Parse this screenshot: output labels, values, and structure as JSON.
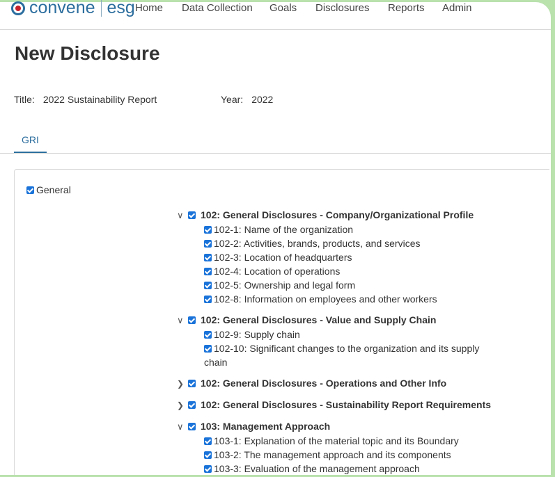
{
  "nav": {
    "logo_left": "convene",
    "logo_right": "esg",
    "items": [
      "Home",
      "Data Collection",
      "Goals",
      "Disclosures",
      "Reports",
      "Admin"
    ]
  },
  "page_title": "New Disclosure",
  "meta": {
    "title_label": "Title:",
    "title_value": "2022 Sustainability Report",
    "year_label": "Year:",
    "year_value": "2022"
  },
  "tabs": [
    "GRI"
  ],
  "general": {
    "label": "General",
    "checked": true
  },
  "groups": [
    {
      "label": "102: General Disclosures - Company/Organizational Profile",
      "expanded": true,
      "checked": true,
      "children": [
        "102-1: Name of the organization",
        "102-2: Activities, brands, products, and services",
        "102-3: Location of headquarters",
        "102-4: Location of operations",
        "102-5: Ownership and legal form",
        "102-8: Information on employees and other workers"
      ]
    },
    {
      "label": "102: General Disclosures - Value and Supply Chain",
      "expanded": true,
      "checked": true,
      "children": [
        "102-9: Supply chain",
        "102-10: Significant changes to the organization and its supply chain"
      ]
    },
    {
      "label": "102: General Disclosures - Operations and Other Info",
      "expanded": false,
      "checked": true,
      "children": []
    },
    {
      "label": "102: General Disclosures - Sustainability Report Requirements",
      "expanded": false,
      "checked": true,
      "children": []
    },
    {
      "label": "103: Management Approach",
      "expanded": true,
      "checked": true,
      "children": [
        "103-1: Explanation of the material topic and its Boundary",
        "103-2: The management approach and its components",
        "103-3: Evaluation of the management approach"
      ]
    }
  ],
  "colors": {
    "brand": "#2c6e9e",
    "checkbox": "#1a73d9",
    "frame": "#b9e2ad"
  }
}
